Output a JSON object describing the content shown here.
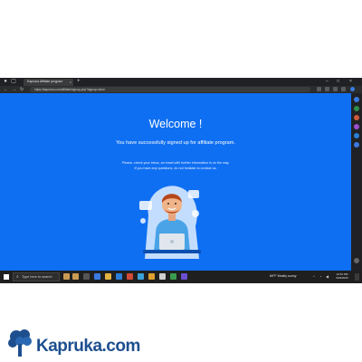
{
  "browser": {
    "tab_title": "Kapruka Affiliate program",
    "new_tab": "+",
    "tab_close": "×",
    "url": "https://kapruka.com/affiliate/signup.php?signup=done",
    "min": "–",
    "max": "□",
    "close": "×"
  },
  "page": {
    "heading": "Welcome !",
    "subtitle": "You have successfully signed up for affiliate program.",
    "message_line1": "Please, check your inbox, an email with further information is on the way.",
    "message_line2": "If you have any questions, do not hesitate to contact us."
  },
  "taskbar": {
    "search_placeholder": "Type here to search",
    "weather": "69°F  Mostly sunny",
    "time": "12:51 PM",
    "date": "6/22/2023"
  },
  "logo": {
    "text": "Kapruka.com"
  },
  "colors": {
    "page_bg": "#0f6ff2",
    "logo": "#1d4f8f"
  }
}
